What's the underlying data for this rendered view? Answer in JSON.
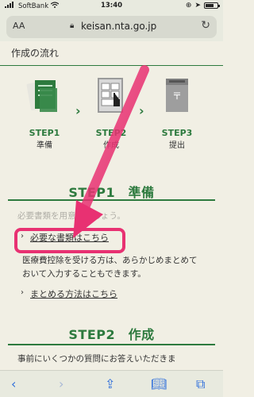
{
  "status": {
    "carrier": "SoftBank",
    "time": "13:40",
    "battery_level": 0.7
  },
  "browser": {
    "aa_label": "AA",
    "url": "keisan.nta.go.jp",
    "icons": [
      "lock-icon",
      "reload-icon",
      "back-icon",
      "forward-icon",
      "share-icon",
      "bookmarks-icon",
      "tabs-icon"
    ]
  },
  "page": {
    "title": "作成の流れ",
    "steps": [
      {
        "label": "STEP1",
        "sub": "準備"
      },
      {
        "label": "STEP2",
        "sub": "作成"
      },
      {
        "label": "STEP3",
        "sub": "提出"
      }
    ],
    "section1_title": "STEP1　準備",
    "section1_hidden_text": "必要書類を用意しましょう。",
    "link_required_docs": "必要な書類はこちら",
    "body_text_line1": "医療費控除を受ける方は、あらかじめまとめて",
    "body_text_line2": "おいて入力することもできます。",
    "link_summarize": "まとめる方法はこちら",
    "section2_title": "STEP2　作成",
    "bottom_text": "事前にいくつかの質問にお答えいただきま"
  },
  "colors": {
    "accent_green": "#2d7a3e",
    "highlight_pink": "#e83172",
    "browser_blue": "#2f6fdb"
  }
}
